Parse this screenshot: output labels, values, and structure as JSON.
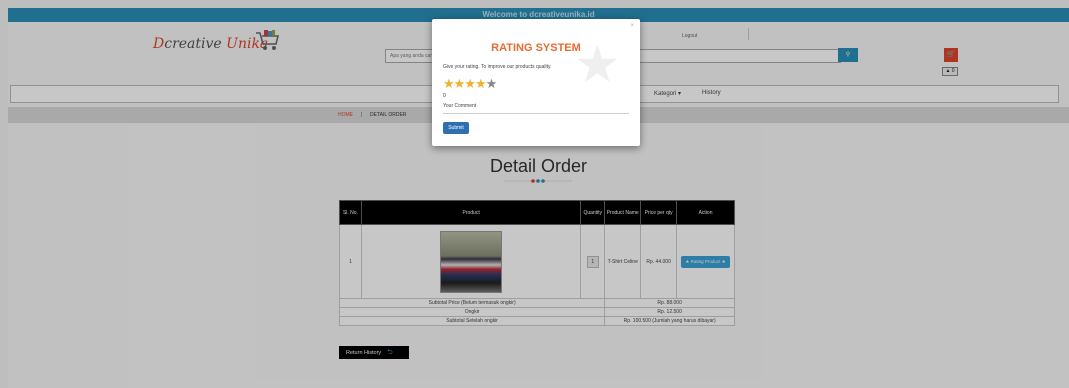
{
  "header": {
    "welcome": "Welcome to dcreativeunika.id",
    "logo_prefix": "D",
    "logo_rest": "creative",
    "logo_accent": "Unika",
    "search_placeholder": "Apa yang anda cari?",
    "login": "Logout",
    "cart_count": "0"
  },
  "nav": {
    "kategori": "Kategori ▾",
    "history": "History"
  },
  "breadcrumb": {
    "home": "HOME",
    "separator": "|",
    "current": "DETAIL ORDER"
  },
  "page_title": "Detail Order",
  "table": {
    "headers": [
      "Sl. No.",
      "Product",
      "Quantity",
      "Product Name",
      "Price per qty",
      "Action"
    ],
    "row": {
      "no": "1",
      "qty": "1",
      "name": "T-Shirt Celine",
      "price": "Rp. 44.000",
      "action": "★ Rating Product ★"
    },
    "summary": [
      {
        "label": "Subtotal Price (Belum termasuk ongkir)",
        "value": "Rp. 88.000"
      },
      {
        "label": "Ongkir",
        "value": "Rp. 12.500"
      },
      {
        "label": "Subtotal Setelah ongkir",
        "value": "Rp. 100.500 (Jumlah yang harus dibayar)"
      }
    ]
  },
  "return_button": "Return History",
  "modal": {
    "title": "RATING SYSTEM",
    "description": "Give your rating. To improve our products quality.",
    "rating": 4,
    "max_rating": 5,
    "rating_value": "0",
    "comment_label": "Your Comment",
    "submit": "Submit",
    "close": "×"
  },
  "colors": {
    "primary": "#2a8fb8",
    "accent": "#e0452b",
    "modal_title": "#e86b2f",
    "star": "#f0b030"
  }
}
